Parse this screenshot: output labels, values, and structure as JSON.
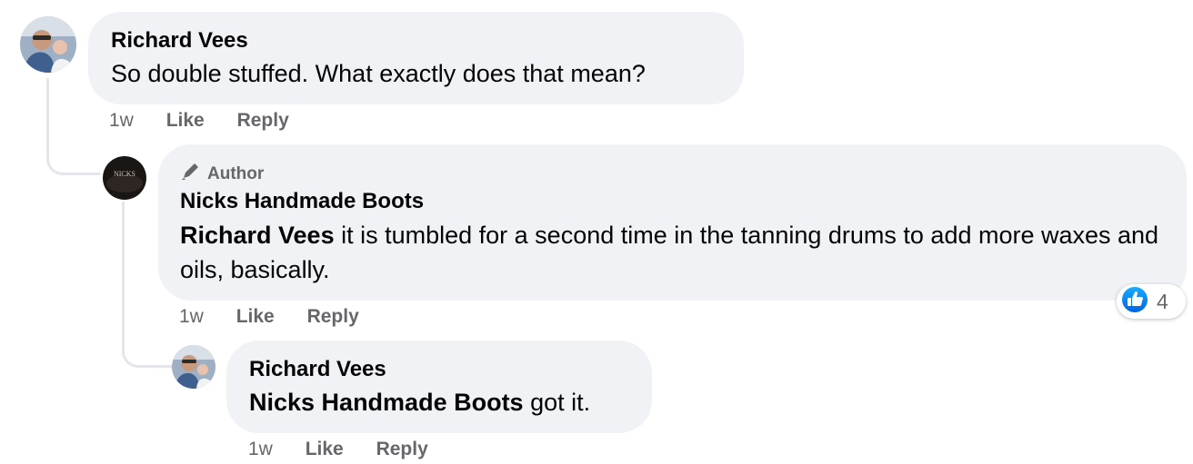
{
  "comments": [
    {
      "author": "Richard Vees",
      "text": "So double stuffed. What exactly does that mean?",
      "time": "1w",
      "like_label": "Like",
      "reply_label": "Reply"
    },
    {
      "badge": "Author",
      "badge_icon": "pen-icon",
      "author": "Nicks Handmade Boots",
      "mention": "Richard Vees",
      "text": " it is tumbled for a second time in the tanning drums to add more waxes and oils, basically.",
      "time": "1w",
      "like_label": "Like",
      "reply_label": "Reply",
      "avatar_text": "NICKS",
      "reaction": {
        "icon": "like-thumb-icon",
        "count": "4",
        "color": "#1877f2"
      }
    },
    {
      "author": "Richard Vees",
      "mention": "Nicks Handmade Boots",
      "text": " got it.",
      "time": "1w",
      "like_label": "Like",
      "reply_label": "Reply"
    }
  ]
}
